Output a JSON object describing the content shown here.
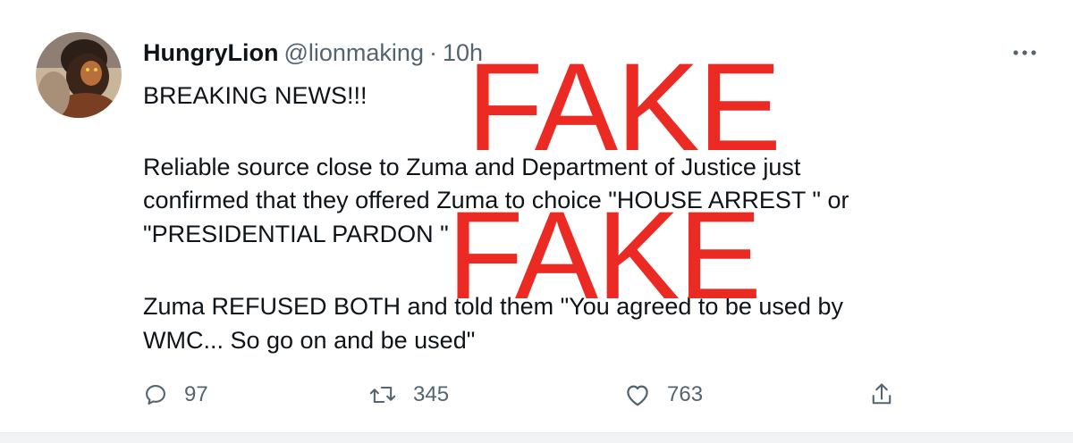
{
  "tweet": {
    "display_name": "HungryLion",
    "handle": "@lionmaking",
    "separator": "·",
    "time": "10h",
    "lines": [
      "BREAKING NEWS!!!",
      "Reliable source close to Zuma and Department of Justice just",
      "confirmed that they offered Zuma to choice \"HOUSE ARREST \" or",
      "\"PRESIDENTIAL PARDON \"",
      "Zuma REFUSED BOTH and told them \"You agreed to be used by",
      "WMC... So go on and be used\""
    ],
    "actions": {
      "reply_count": "97",
      "retweet_count": "345",
      "like_count": "763"
    }
  },
  "overlay": {
    "stamp_top": "FAKE",
    "stamp_bottom": "FAKE",
    "color": "#ec2a24"
  },
  "icons": {
    "avatar": "avatar",
    "more": "more-icon",
    "reply": "reply-icon",
    "retweet": "retweet-icon",
    "like": "heart-icon",
    "share": "share-icon"
  }
}
